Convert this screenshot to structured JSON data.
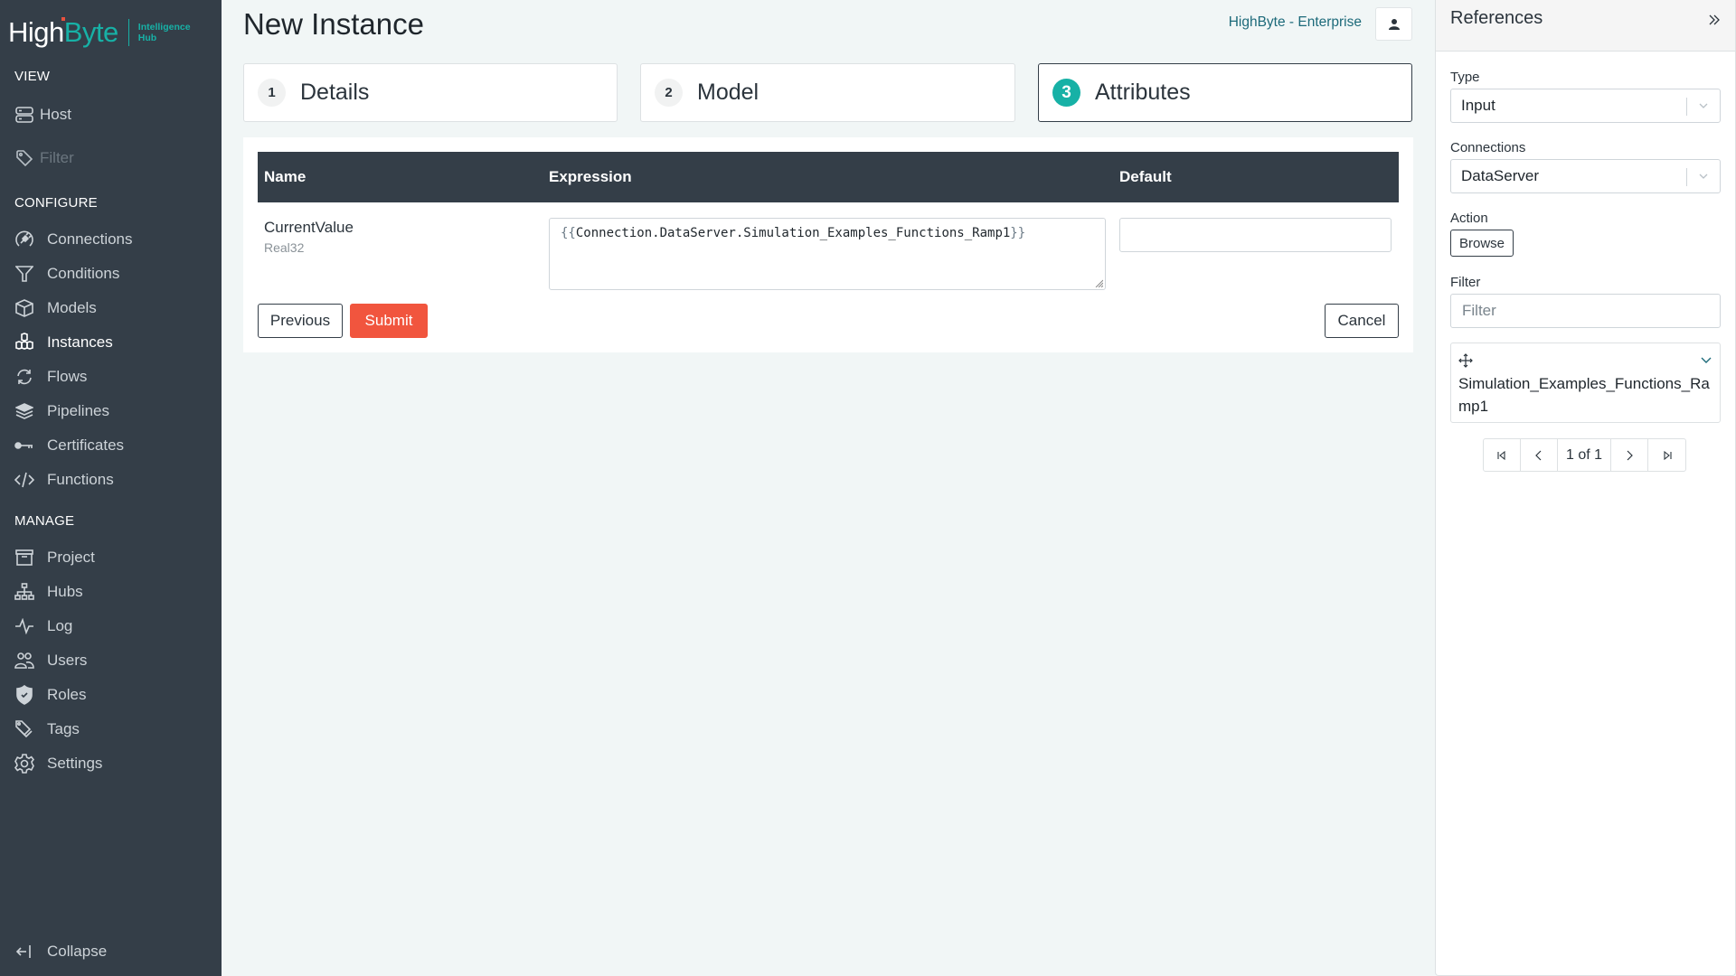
{
  "brand": {
    "name_part1": "High",
    "name_part2": "Byte",
    "subtitle_line1": "Intelligence",
    "subtitle_line2": "Hub",
    "accent_color": "#17b1a6",
    "sidebar_color": "#343e48",
    "submit_color": "#f1553e"
  },
  "sidebar": {
    "sections": [
      {
        "label": "VIEW"
      },
      {
        "label": "CONFIGURE"
      },
      {
        "label": "MANAGE"
      }
    ],
    "view_items": [
      {
        "label": "Host",
        "icon": "server-icon"
      },
      {
        "label": "Filter",
        "icon": "tag-icon",
        "disabled": true
      }
    ],
    "configure_items": [
      {
        "label": "Connections",
        "icon": "plug-icon"
      },
      {
        "label": "Conditions",
        "icon": "funnel-icon"
      },
      {
        "label": "Models",
        "icon": "cube-icon"
      },
      {
        "label": "Instances",
        "icon": "cubes-icon",
        "active": true
      },
      {
        "label": "Flows",
        "icon": "sync-icon"
      },
      {
        "label": "Pipelines",
        "icon": "layers-icon"
      },
      {
        "label": "Certificates",
        "icon": "key-icon"
      },
      {
        "label": "Functions",
        "icon": "code-icon"
      }
    ],
    "manage_items": [
      {
        "label": "Project",
        "icon": "archive-icon"
      },
      {
        "label": "Hubs",
        "icon": "network-icon"
      },
      {
        "label": "Log",
        "icon": "pulse-icon"
      },
      {
        "label": "Users",
        "icon": "users-icon"
      },
      {
        "label": "Roles",
        "icon": "shield-icon"
      },
      {
        "label": "Tags",
        "icon": "tags-icon"
      },
      {
        "label": "Settings",
        "icon": "gear-icon"
      }
    ],
    "collapse_label": "Collapse"
  },
  "header": {
    "title": "New Instance",
    "account_link": "HighByte - Enterprise"
  },
  "steps": [
    {
      "number": "1",
      "label": "Details"
    },
    {
      "number": "2",
      "label": "Model"
    },
    {
      "number": "3",
      "label": "Attributes",
      "active": true
    }
  ],
  "attributes_table": {
    "columns": [
      "Name",
      "Expression",
      "Default"
    ],
    "rows": [
      {
        "name": "CurrentValue",
        "type": "Real32",
        "expression_open": "{{",
        "expression_body": "Connection.DataServer.Simulation_Examples_Functions_Ramp1",
        "expression_close": "}}",
        "default": ""
      }
    ]
  },
  "actions": {
    "previous": "Previous",
    "submit": "Submit",
    "cancel": "Cancel"
  },
  "references": {
    "title": "References",
    "type_label": "Type",
    "type_value": "Input",
    "connections_label": "Connections",
    "connections_value": "DataServer",
    "action_label": "Action",
    "browse_button": "Browse",
    "filter_label": "Filter",
    "filter_placeholder": "Filter",
    "filter_value": "",
    "items": [
      {
        "name": "Simulation_Examples_Functions_Ramp1"
      }
    ],
    "pagination": "1 of 1"
  }
}
